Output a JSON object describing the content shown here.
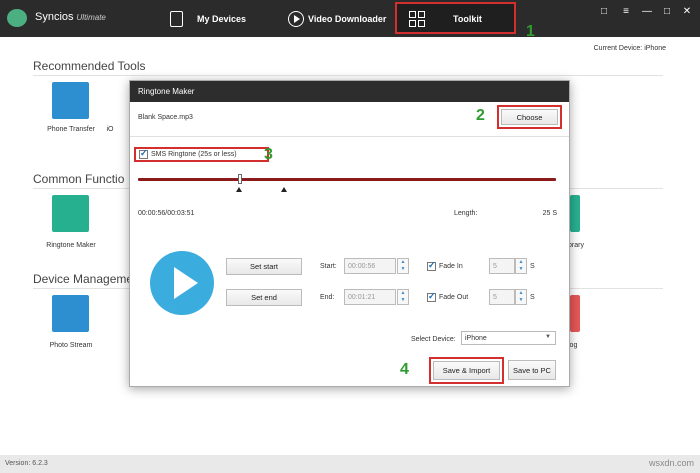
{
  "app": {
    "name": "Syncios",
    "edition": "Ultimate",
    "version": "Version: 6.2.3"
  },
  "nav": {
    "my_devices": "My Devices",
    "video_downloader": "Video Downloader",
    "toolkit": "Toolkit"
  },
  "window_controls": [
    "□",
    "≡",
    "—",
    "□",
    "✕"
  ],
  "current_device": "Current Device: iPhone",
  "steps": [
    "1",
    "2",
    "3",
    "4"
  ],
  "sections": {
    "recommended": {
      "title": "Recommended Tools",
      "items": [
        "Phone Transfer",
        "iO"
      ]
    },
    "common": {
      "title": "Common Functio",
      "items": [
        "Ringtone Maker",
        "brary"
      ]
    },
    "device": {
      "title": "Device Manageme",
      "items": [
        "Photo Stream",
        "log"
      ]
    }
  },
  "modal": {
    "title": "Ringtone Maker",
    "file_name": "Blank Space.mp3",
    "choose_label": "Choose",
    "sms_label": "SMS Ringtone (25s or less)",
    "sms_checked": true,
    "time_display": "00:00:56/00:03:51",
    "length_label": "Length:",
    "length_value": "25 S",
    "set_start_label": "Set start",
    "set_end_label": "Set end",
    "start_label": "Start:",
    "start_value": "00:00:56",
    "end_label": "End:",
    "end_value": "00:01:21",
    "fade_in_label": "Fade In",
    "fade_in_value": "5",
    "fade_out_label": "Fade Out",
    "fade_out_value": "5",
    "unit": "S",
    "select_device_label": "Select Device:",
    "select_device_value": "iPhone",
    "save_import_label": "Save & Import",
    "save_pc_label": "Save to PC"
  },
  "watermark": "wsxdn.com",
  "colors": {
    "accent_red": "#d32f2f",
    "step_green": "#2e9b2e",
    "play_blue": "#3aacde",
    "topbar": "#2b2b2b"
  }
}
